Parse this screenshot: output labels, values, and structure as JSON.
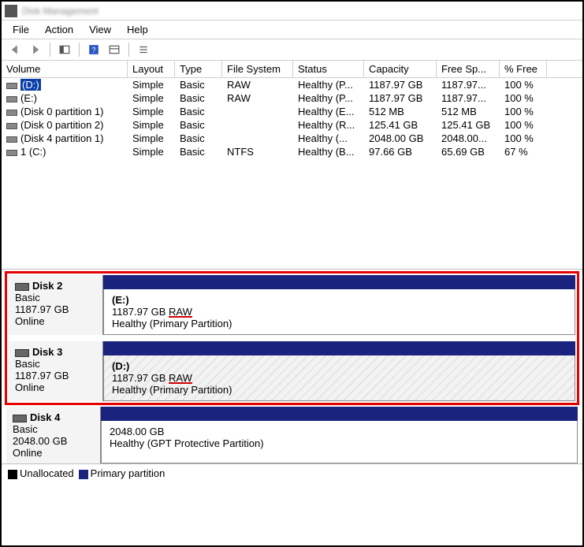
{
  "title": "Disk Management",
  "menu": {
    "file": "File",
    "action": "Action",
    "view": "View",
    "help": "Help"
  },
  "columns": {
    "volume": "Volume",
    "layout": "Layout",
    "type": "Type",
    "fs": "File System",
    "status": "Status",
    "capacity": "Capacity",
    "free": "Free Sp...",
    "pct": "% Free"
  },
  "volumes": [
    {
      "name": "(D:)",
      "layout": "Simple",
      "type": "Basic",
      "fs": "RAW",
      "status": "Healthy (P...",
      "capacity": "1187.97 GB",
      "free": "1187.97...",
      "pct": "100 %",
      "selected": true
    },
    {
      "name": "(E:)",
      "layout": "Simple",
      "type": "Basic",
      "fs": "RAW",
      "status": "Healthy (P...",
      "capacity": "1187.97 GB",
      "free": "1187.97...",
      "pct": "100 %"
    },
    {
      "name": "(Disk 0 partition 1)",
      "layout": "Simple",
      "type": "Basic",
      "fs": "",
      "status": "Healthy (E...",
      "capacity": "512 MB",
      "free": "512 MB",
      "pct": "100 %"
    },
    {
      "name": "(Disk 0 partition 2)",
      "layout": "Simple",
      "type": "Basic",
      "fs": "",
      "status": "Healthy (R...",
      "capacity": "125.41 GB",
      "free": "125.41 GB",
      "pct": "100 %"
    },
    {
      "name": "(Disk 4 partition 1)",
      "layout": "Simple",
      "type": "Basic",
      "fs": "",
      "status": "Healthy (...",
      "capacity": "2048.00 GB",
      "free": "2048.00...",
      "pct": "100 %"
    },
    {
      "name": "1 (C:)",
      "layout": "Simple",
      "type": "Basic",
      "fs": "NTFS",
      "status": "Healthy (B...",
      "capacity": "97.66 GB",
      "free": "65.69 GB",
      "pct": "67 %"
    }
  ],
  "disks": {
    "d2": {
      "name": "Disk 2",
      "type": "Basic",
      "size": "1187.97 GB",
      "state": "Online",
      "part_name": "(E:)",
      "part_size_prefix": "1187.97 GB ",
      "part_fs": "RAW",
      "part_status": "Healthy (Primary Partition)"
    },
    "d3": {
      "name": "Disk 3",
      "type": "Basic",
      "size": "1187.97 GB",
      "state": "Online",
      "part_name": "(D:)",
      "part_size_prefix": "1187.97 GB ",
      "part_fs": "RAW",
      "part_status": "Healthy (Primary Partition)"
    },
    "d4": {
      "name": "Disk 4",
      "type": "Basic",
      "size": "2048.00 GB",
      "state": "Online",
      "part_name": "",
      "part_size": "2048.00 GB",
      "part_status": "Healthy (GPT Protective Partition)"
    }
  },
  "legend": {
    "unalloc": "Unallocated",
    "primary": "Primary partition"
  }
}
